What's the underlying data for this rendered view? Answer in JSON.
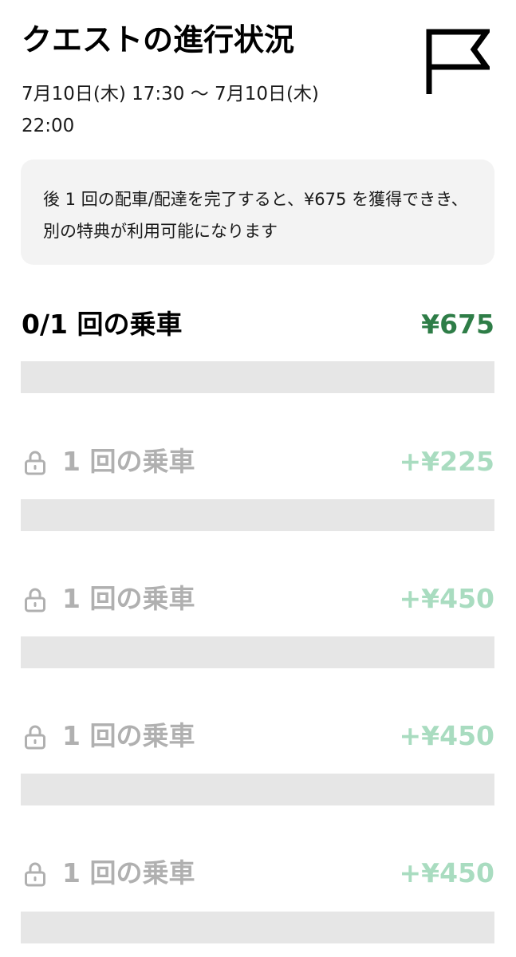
{
  "header": {
    "title": "クエストの進行状況",
    "date_range": "7月10日(木) 17:30 〜 7月10日(木) 22:00"
  },
  "info": {
    "message": "後 1 回の配車/配達を完了すると、¥675 を獲得できき、別の特典が利用可能になります"
  },
  "progress": {
    "label": "0/1 回の乗車",
    "amount": "¥675",
    "fraction": 0
  },
  "tiers": [
    {
      "label": "1 回の乗車",
      "amount": "+¥225",
      "locked": true
    },
    {
      "label": "1 回の乗車",
      "amount": "+¥450",
      "locked": true
    },
    {
      "label": "1 回の乗車",
      "amount": "+¥450",
      "locked": true
    },
    {
      "label": "1 回の乗車",
      "amount": "+¥450",
      "locked": true
    }
  ],
  "colors": {
    "accent_green": "#2e7d47",
    "locked_green": "#a9dcc0",
    "locked_text": "#b0b0b0",
    "bar_track": "#e6e6e6",
    "card_bg": "#f3f3f3"
  },
  "icons": {
    "header": "flag-icon",
    "tier": "lock-icon"
  }
}
